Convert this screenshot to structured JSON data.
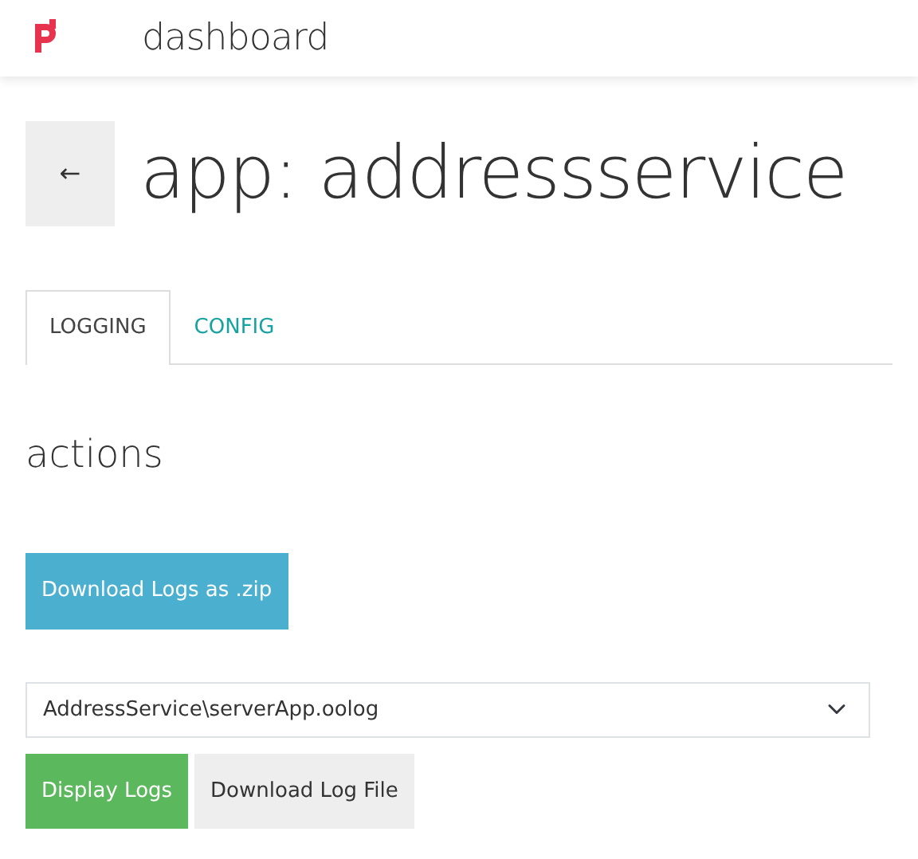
{
  "navbar": {
    "brand": "dashboard"
  },
  "header": {
    "back": "←",
    "title": "app: addressservice"
  },
  "tabs": [
    {
      "label": "LOGGING",
      "selected": true
    },
    {
      "label": "CONFIG",
      "selected": false
    }
  ],
  "section": {
    "title": "actions"
  },
  "zip_button": "Download Logs as .zip",
  "log_select": {
    "value": "AddressService\\serverApp.oolog"
  },
  "buttons": [
    {
      "label": "Display Logs",
      "kind": "success"
    },
    {
      "label": "Download Log File",
      "kind": "light"
    }
  ]
}
